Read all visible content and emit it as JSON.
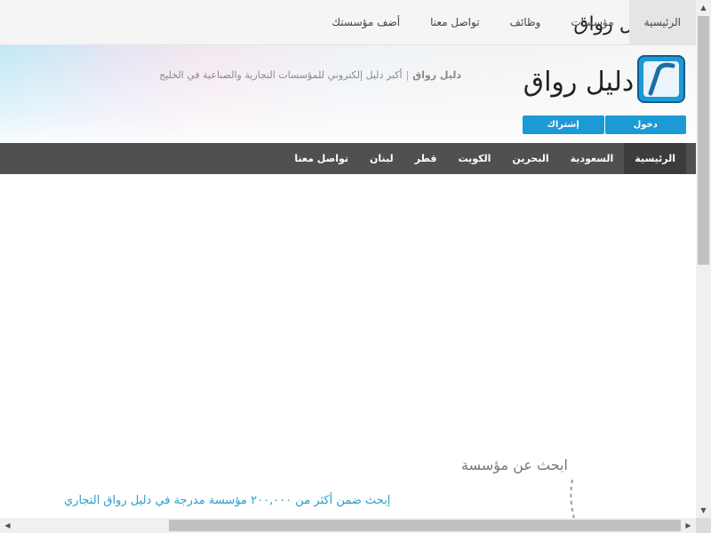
{
  "topnav": {
    "items": [
      {
        "label": "الرئيسية",
        "active": true
      },
      {
        "label": "مؤسسات"
      },
      {
        "label": "وظائف"
      },
      {
        "label": "تواصل معنا"
      },
      {
        "label": "أضف مؤسستك"
      }
    ]
  },
  "brand": {
    "logo_text": "دليل رواق",
    "accent": "#1c9ad6"
  },
  "header": {
    "tagline_brand": "دليل رواق",
    "tagline_separator": "|",
    "tagline": "أكبر دليل إلكتروني للمؤسسات التجارية والصناعية في الخليج",
    "login_label": "دخول",
    "signup_label": "إشتراك"
  },
  "mainnav": {
    "items": [
      {
        "label": "الرئيسية",
        "active": true
      },
      {
        "label": "السعودية"
      },
      {
        "label": "البحرين"
      },
      {
        "label": "الكويت"
      },
      {
        "label": "قطر"
      },
      {
        "label": "لبنان"
      },
      {
        "label": "تواصل معنا"
      }
    ]
  },
  "search": {
    "heading": "ابحث عن مؤسسة",
    "subheading": "إبحث ضمن أكثر من ٢٠٠,٠٠٠ مؤسسة مدرجة في دليل رواق التجاري"
  }
}
